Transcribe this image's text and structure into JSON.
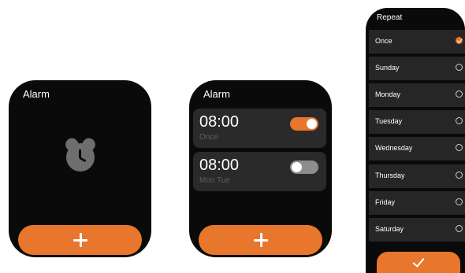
{
  "screens": {
    "empty": {
      "title": "Alarm",
      "icon": "alarm-clock-icon",
      "add_icon": "plus-icon"
    },
    "list": {
      "title": "Alarm",
      "alarms": [
        {
          "time": "08:00",
          "repeat": "Once",
          "enabled": true
        },
        {
          "time": "08:00",
          "repeat": "Mon Tue",
          "enabled": false
        }
      ],
      "add_icon": "plus-icon"
    },
    "repeat": {
      "title": "Repeat",
      "options": [
        {
          "label": "Once",
          "checked": true
        },
        {
          "label": "Sunday",
          "checked": false
        },
        {
          "label": "Monday",
          "checked": false
        },
        {
          "label": "Tuesday",
          "checked": false
        },
        {
          "label": "Wednesday",
          "checked": false
        },
        {
          "label": "Thursday",
          "checked": false
        },
        {
          "label": "Friday",
          "checked": false
        },
        {
          "label": "Saturday",
          "checked": false
        }
      ],
      "confirm_icon": "checkmark-icon"
    }
  },
  "colors": {
    "accent": "#e8762c",
    "screen_bg": "#0a0a0a",
    "card_bg": "#2a2a2a",
    "muted_text": "#5e5e5e"
  }
}
